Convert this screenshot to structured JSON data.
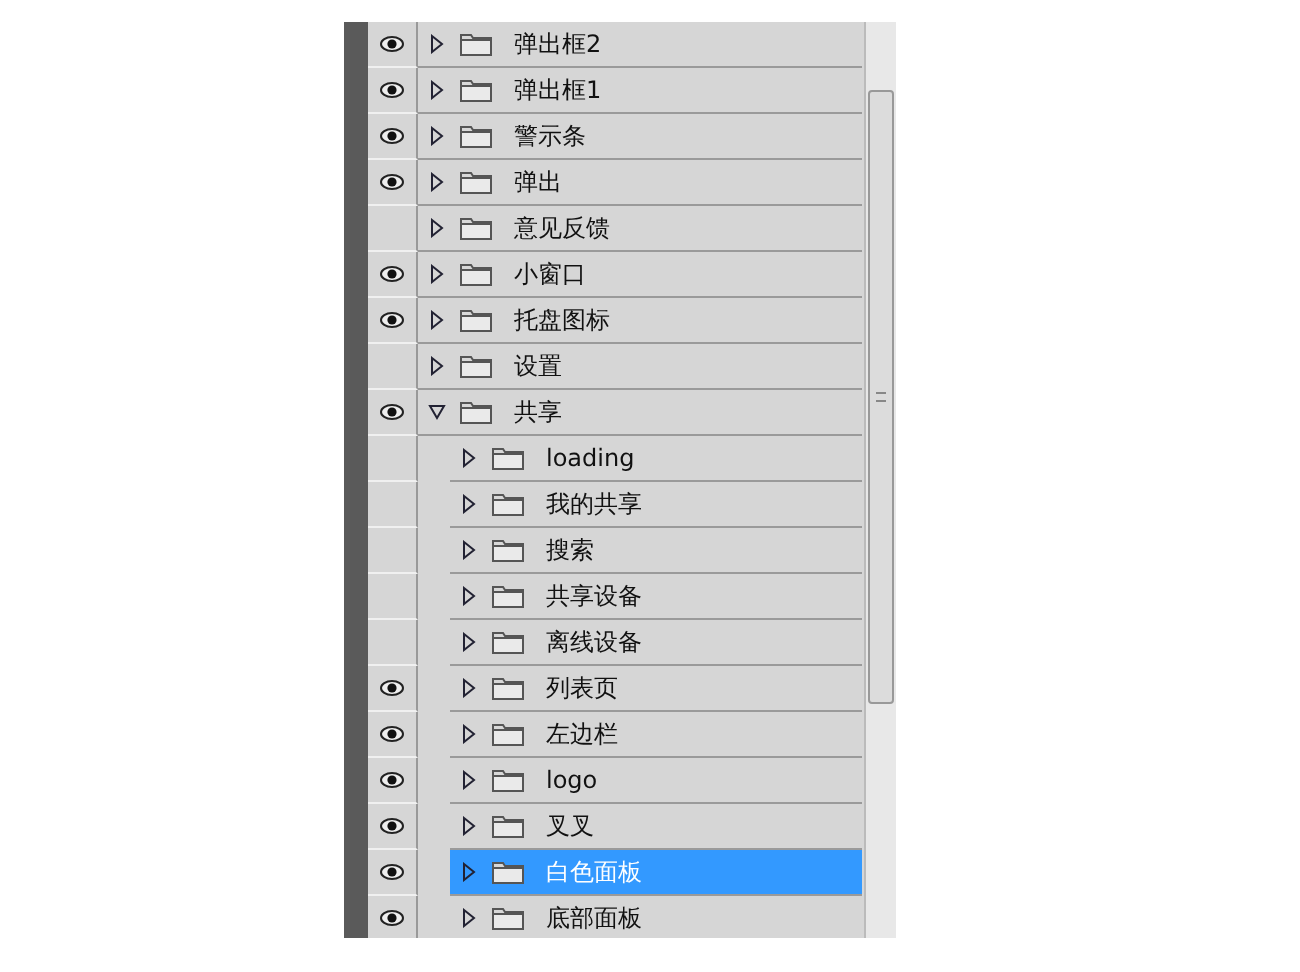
{
  "layers": [
    {
      "name": "弹出框2",
      "visible": true,
      "expanded": false,
      "selected": false
    },
    {
      "name": "弹出框1",
      "visible": true,
      "expanded": false,
      "selected": false
    },
    {
      "name": "警示条",
      "visible": true,
      "expanded": false,
      "selected": false
    },
    {
      "name": "弹出",
      "visible": true,
      "expanded": false,
      "selected": false
    },
    {
      "name": "意见反馈",
      "visible": false,
      "expanded": false,
      "selected": false
    },
    {
      "name": "小窗口",
      "visible": true,
      "expanded": false,
      "selected": false
    },
    {
      "name": "托盘图标",
      "visible": true,
      "expanded": false,
      "selected": false
    },
    {
      "name": "设置",
      "visible": false,
      "expanded": false,
      "selected": false
    },
    {
      "name": "共享",
      "visible": true,
      "expanded": true,
      "selected": false,
      "children": [
        {
          "name": "loading",
          "visible": false,
          "expanded": false,
          "selected": false
        },
        {
          "name": "我的共享",
          "visible": false,
          "expanded": false,
          "selected": false
        },
        {
          "name": "搜索",
          "visible": false,
          "expanded": false,
          "selected": false
        },
        {
          "name": "共享设备",
          "visible": false,
          "expanded": false,
          "selected": false
        },
        {
          "name": "离线设备",
          "visible": false,
          "expanded": false,
          "selected": false
        },
        {
          "name": "列表页",
          "visible": true,
          "expanded": false,
          "selected": false
        },
        {
          "name": "左边栏",
          "visible": true,
          "expanded": false,
          "selected": false
        },
        {
          "name": "logo",
          "visible": true,
          "expanded": false,
          "selected": false
        },
        {
          "name": "叉叉",
          "visible": true,
          "expanded": false,
          "selected": false
        },
        {
          "name": "白色面板",
          "visible": true,
          "expanded": false,
          "selected": true
        },
        {
          "name": "底部面板",
          "visible": true,
          "expanded": false,
          "selected": false
        }
      ]
    }
  ]
}
